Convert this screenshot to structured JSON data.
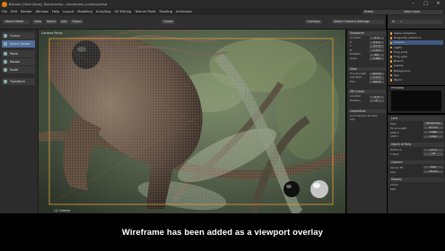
{
  "window": {
    "title": "Blender [Gold Zone]: Documents/…/wireframe_overlay.blend"
  },
  "menubar": {
    "items": [
      "File",
      "Edit",
      "Render",
      "Window",
      "Help",
      "Layout",
      "Modeling",
      "Sculpting",
      "UV Editing",
      "Texture Paint",
      "Shading",
      "Animation"
    ],
    "scene": "Scene",
    "layer": "View Layer"
  },
  "header": {
    "mode": "Object Mode",
    "menus": [
      "View",
      "Select",
      "Add",
      "Object"
    ],
    "transform": "Global",
    "overlays": "Overlays",
    "camera_settings": "Select Camera Settings"
  },
  "toolbar": {
    "items": [
      {
        "label": "Cursor"
      },
      {
        "label": "Select Border",
        "active": true
      },
      {
        "label": "Move"
      },
      {
        "label": "Rotate"
      },
      {
        "label": "Scale"
      },
      {
        "label": "Transform"
      }
    ]
  },
  "viewport": {
    "camera_label": "Camera Persp",
    "object_label": "(1) Camera",
    "overlay": "wireframe"
  },
  "npanel": {
    "sections": [
      {
        "title": "Transform",
        "rows": [
          [
            "Location",
            "0 m"
          ],
          [
            "X",
            "0.2 m"
          ],
          [
            "Y",
            "-3.1 m"
          ],
          [
            "Z",
            "1.4 m"
          ],
          [
            "Rotation",
            "90°"
          ],
          [
            "Scale",
            "1.000"
          ]
        ]
      },
      {
        "title": "View",
        "rows": [
          [
            "Focal Length",
            "50 mm"
          ],
          [
            "Clip Start",
            "0.1 m"
          ],
          [
            "End",
            "100 m"
          ]
        ]
      },
      {
        "title": "3D Cursor",
        "rows": [
          [
            "Location",
            "0 m"
          ],
          [
            "Rotation",
            "0°"
          ]
        ]
      },
      {
        "title": "Collections",
        "rows": [
          [
            "Lock Camera to View",
            ""
          ],
          [
            "Clip",
            ""
          ]
        ]
      }
    ]
  },
  "outliner": {
    "items": [
      "Scene Collection",
      "Dragonfly_reference",
      "Camera",
      "Lights",
      "Frog_body",
      "Frog_eyes",
      "Branch",
      "Leaves",
      "Background",
      "Sun",
      "World"
    ],
    "selected": 2
  },
  "properties": {
    "preview_label": "Preview",
    "sections": [
      {
        "title": "Lens",
        "rows": [
          [
            "Type",
            "Perspective"
          ],
          [
            "Focal Length",
            "50 mm"
          ],
          [
            "Shift X",
            "0.000"
          ],
          [
            "Shift Y",
            "0.000"
          ]
        ]
      },
      {
        "title": "Depth of Field",
        "rows": [
          [
            "Distance",
            "4.5 m"
          ],
          [
            "F-Stop",
            "2.8"
          ]
        ]
      },
      {
        "title": "Camera",
        "rows": [
          [
            "Sensor Fit",
            "Auto"
          ],
          [
            "Size",
            "36 mm"
          ]
        ]
      },
      {
        "title": "Display",
        "rows": [
          [
            "Limits",
            ""
          ],
          [
            "Mist",
            ""
          ]
        ]
      }
    ]
  },
  "subtitle": "Wireframe has been added as a viewport overlay",
  "colors": {
    "accent": "#e0a03b",
    "selection": "#4f6f9b",
    "background": "#2b2b2b"
  }
}
